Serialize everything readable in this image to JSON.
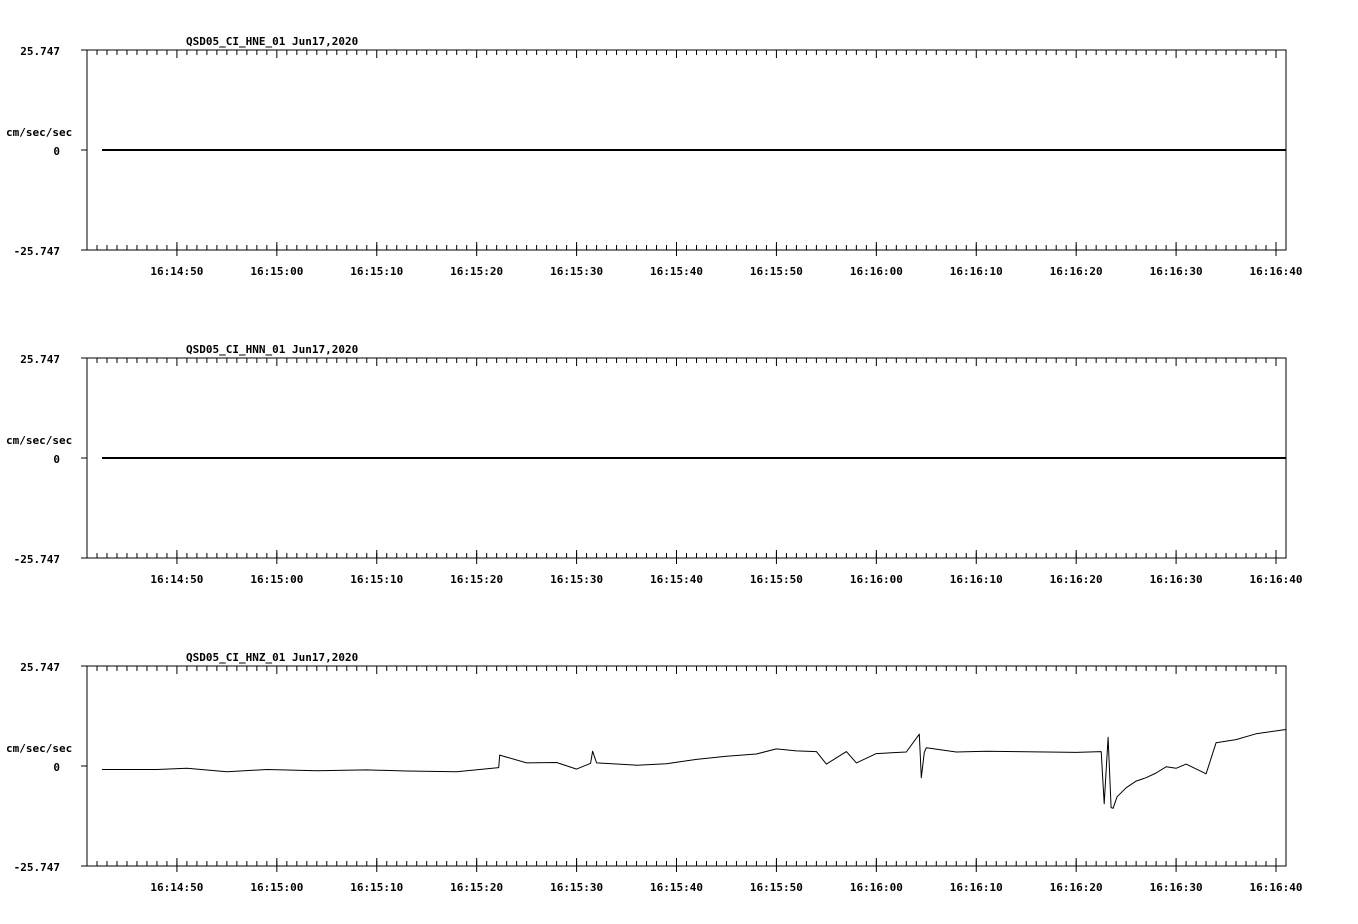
{
  "chart_data": [
    {
      "type": "line",
      "title": "QSD05_CI_HNE_01  Jun17,2020",
      "ylabel": "cm/sec/sec",
      "ylim": [
        -25.747,
        25.747
      ],
      "yticks": [
        "25.747",
        "0",
        "-25.747"
      ],
      "xlim": [
        "16:14:41",
        "16:16:41"
      ],
      "xticks": [
        "16:14:50",
        "16:15:00",
        "16:15:10",
        "16:15:20",
        "16:15:30",
        "16:15:40",
        "16:15:50",
        "16:16:00",
        "16:16:10",
        "16:16:20",
        "16:16:30",
        "16:16:40"
      ],
      "grid": false,
      "series": [
        {
          "x": [
            "16:14:42.5",
            "16:16:41"
          ],
          "y": [
            0,
            0
          ]
        }
      ]
    },
    {
      "type": "line",
      "title": "QSD05_CI_HNN_01  Jun17,2020",
      "ylabel": "cm/sec/sec",
      "ylim": [
        -25.747,
        25.747
      ],
      "yticks": [
        "25.747",
        "0",
        "-25.747"
      ],
      "xlim": [
        "16:14:41",
        "16:16:41"
      ],
      "xticks": [
        "16:14:50",
        "16:15:00",
        "16:15:10",
        "16:15:20",
        "16:15:30",
        "16:15:40",
        "16:15:50",
        "16:16:00",
        "16:16:10",
        "16:16:20",
        "16:16:30",
        "16:16:40"
      ],
      "grid": false,
      "series": [
        {
          "x": [
            "16:14:42.5",
            "16:16:41"
          ],
          "y": [
            0,
            0
          ]
        }
      ]
    },
    {
      "type": "line",
      "title": "QSD05_CI_HNZ_01  Jun17,2020",
      "ylabel": "cm/sec/sec",
      "ylim": [
        -25.747,
        25.747
      ],
      "yticks": [
        "25.747",
        "0",
        "-25.747"
      ],
      "xlim": [
        "16:14:41",
        "16:16:41"
      ],
      "xticks": [
        "16:14:50",
        "16:15:00",
        "16:15:10",
        "16:15:20",
        "16:15:30",
        "16:15:40",
        "16:15:50",
        "16:16:00",
        "16:16:10",
        "16:16:20",
        "16:16:30",
        "16:16:40"
      ],
      "grid": false,
      "series": [
        {
          "x": [
            "16:14:42.5",
            "16:14:48",
            "16:14:51",
            "16:14:55",
            "16:14:59",
            "16:15:04",
            "16:15:09",
            "16:15:13",
            "16:15:18",
            "16:15:22.2",
            "16:15:22.3",
            "16:15:25",
            "16:15:28",
            "16:15:30",
            "16:15:31.4",
            "16:15:31.6",
            "16:15:32",
            "16:15:36",
            "16:15:39",
            "16:15:42",
            "16:15:45",
            "16:15:48",
            "16:15:50",
            "16:15:52",
            "16:15:54",
            "16:15:55",
            "16:15:57",
            "16:15:58",
            "16:16:00",
            "16:16:03",
            "16:16:04.3",
            "16:16:04.5",
            "16:16:04.8",
            "16:16:05",
            "16:16:08",
            "16:16:11",
            "16:16:14",
            "16:16:17",
            "16:16:20",
            "16:16:22.5",
            "16:16:22.8",
            "16:16:23.2",
            "16:16:23.5",
            "16:16:23.7",
            "16:16:24.1",
            "16:16:25",
            "16:16:26",
            "16:16:27",
            "16:16:28",
            "16:16:29",
            "16:16:30",
            "16:16:31",
            "16:16:33",
            "16:16:34",
            "16:16:36",
            "16:16:38",
            "16:16:41"
          ],
          "y": [
            -0.9,
            -0.9,
            -0.6,
            -1.5,
            -0.9,
            -1.2,
            -1.0,
            -1.3,
            -1.5,
            -0.4,
            2.8,
            0.8,
            0.9,
            -0.8,
            0.7,
            3.8,
            0.8,
            0.2,
            0.6,
            1.7,
            2.5,
            3.1,
            4.4,
            3.9,
            3.7,
            0.5,
            3.7,
            0.8,
            3.2,
            3.6,
            8.2,
            -3.0,
            3.5,
            4.7,
            3.6,
            3.8,
            3.7,
            3.6,
            3.5,
            3.7,
            -9.7,
            7.4,
            -10.7,
            -10.9,
            -7.9,
            -5.6,
            -3.9,
            -3.0,
            -1.8,
            -0.2,
            -0.6,
            0.5,
            -2.0,
            6.0,
            6.8,
            8.3,
            9.4
          ]
        }
      ]
    }
  ]
}
